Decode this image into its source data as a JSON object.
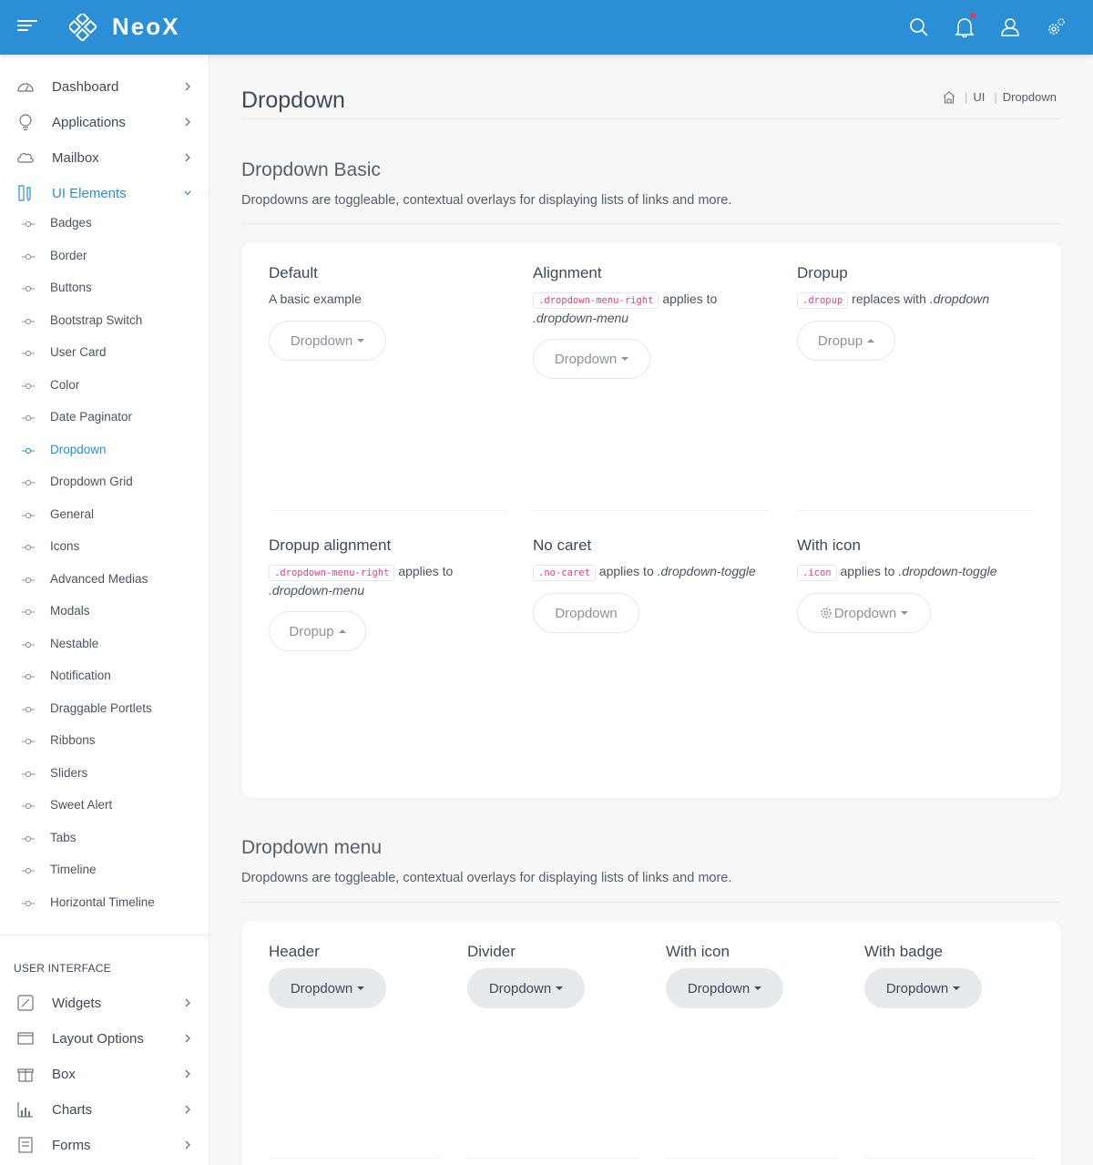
{
  "header": {
    "brand": "NeoX",
    "accent_color": "#2b8fd6",
    "icons": [
      "menu-icon",
      "search-icon",
      "bell-icon",
      "user-icon",
      "gear-icon"
    ]
  },
  "sidebar": {
    "top_items": [
      {
        "label": "Dashboard",
        "icon": "gauge-icon"
      },
      {
        "label": "Applications",
        "icon": "bulb-icon"
      },
      {
        "label": "Mailbox",
        "icon": "cloud-mail-icon"
      },
      {
        "label": "UI Elements",
        "icon": "pencil-ruler-icon",
        "expanded": true
      }
    ],
    "ui_elements": [
      "Badges",
      "Border",
      "Buttons",
      "Bootstrap Switch",
      "User Card",
      "Color",
      "Date Paginator",
      "Dropdown",
      "Dropdown Grid",
      "General",
      "Icons",
      "Advanced Medias",
      "Modals",
      "Nestable",
      "Notification",
      "Draggable Portlets",
      "Ribbons",
      "Sliders",
      "Sweet Alert",
      "Tabs",
      "Timeline",
      "Horizontal Timeline"
    ],
    "active_sub": "Dropdown",
    "section_label": "USER INTERFACE",
    "bottom_items": [
      {
        "label": "Widgets",
        "icon": "widgets-icon"
      },
      {
        "label": "Layout Options",
        "icon": "layout-icon"
      },
      {
        "label": "Box",
        "icon": "gift-box-icon"
      },
      {
        "label": "Charts",
        "icon": "bar-chart-icon"
      },
      {
        "label": "Forms",
        "icon": "form-icon"
      }
    ]
  },
  "page": {
    "title": "Dropdown",
    "breadcrumb": [
      "UI",
      "Dropdown"
    ]
  },
  "basic": {
    "title": "Dropdown Basic",
    "desc": "Dropdowns are toggleable, contextual overlays for displaying lists of links and more.",
    "demos": {
      "default": {
        "title": "Default",
        "desc": "A basic example",
        "button": "Dropdown"
      },
      "alignment": {
        "title": "Alignment",
        "code": ".dropdown-menu-right",
        "desc_mid": "applies to",
        "desc_em": ".dropdown-menu",
        "button": "Dropdown"
      },
      "dropup": {
        "title": "Dropup",
        "code": ".dropup",
        "desc_mid": "replaces with",
        "desc_em": ".dropdown",
        "button": "Dropup"
      },
      "dropup_alignment": {
        "title": "Dropup alignment",
        "code": ".dropdown-menu-right",
        "desc_mid": "applies to",
        "desc_em": ".dropdown-menu",
        "button": "Dropup"
      },
      "no_caret": {
        "title": "No caret",
        "code": ".no-caret",
        "desc_mid": "applies to",
        "desc_em": ".dropdown-toggle",
        "button": "Dropdown"
      },
      "with_icon": {
        "title": "With icon",
        "code": ".icon",
        "desc_mid": "applies to",
        "desc_em": ".dropdown-toggle",
        "button": "Dropdown"
      }
    }
  },
  "menu": {
    "title": "Dropdown menu",
    "desc": "Dropdowns are toggleable, contextual overlays for displaying lists of links and more.",
    "demos": [
      {
        "title": "Header",
        "button": "Dropdown"
      },
      {
        "title": "Divider",
        "button": "Dropdown"
      },
      {
        "title": "With icon",
        "button": "Dropdown"
      },
      {
        "title": "With badge",
        "button": "Dropdown"
      }
    ]
  }
}
